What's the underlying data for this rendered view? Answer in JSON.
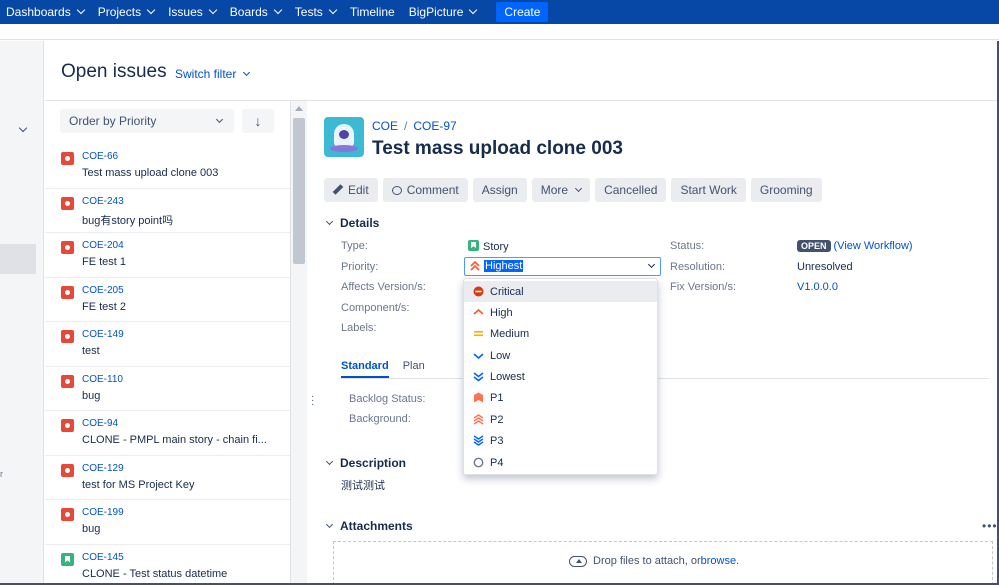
{
  "nav": {
    "items": [
      {
        "label": "Dashboards",
        "has_menu": true
      },
      {
        "label": "Projects",
        "has_menu": true
      },
      {
        "label": "Issues",
        "has_menu": true
      },
      {
        "label": "Boards",
        "has_menu": true
      },
      {
        "label": "Tests",
        "has_menu": true
      },
      {
        "label": "Timeline",
        "has_menu": false
      },
      {
        "label": "BigPicture",
        "has_menu": true
      }
    ],
    "create_label": "Create"
  },
  "page": {
    "title": "Open issues",
    "switch_filter": "Switch filter"
  },
  "list": {
    "order_by": "Order by Priority",
    "sort_icon": "↓",
    "issues": [
      {
        "key": "COE-66",
        "summary": "Test mass upload clone 003",
        "type": "bug"
      },
      {
        "key": "COE-243",
        "summary": "bug有story point吗",
        "type": "bug"
      },
      {
        "key": "COE-204",
        "summary": "FE test 1",
        "type": "bug"
      },
      {
        "key": "COE-205",
        "summary": "FE test 2",
        "type": "bug"
      },
      {
        "key": "COE-149",
        "summary": "test",
        "type": "bug"
      },
      {
        "key": "COE-110",
        "summary": "bug",
        "type": "bug"
      },
      {
        "key": "COE-94",
        "summary": "CLONE - PMPL main story - chain fi...",
        "type": "bug"
      },
      {
        "key": "COE-129",
        "summary": "test for MS Project Key",
        "type": "bug"
      },
      {
        "key": "COE-199",
        "summary": "bug",
        "type": "bug"
      },
      {
        "key": "COE-145",
        "summary": "CLONE - Test status datetime",
        "type": "story"
      }
    ]
  },
  "issue": {
    "project": "COE",
    "key": "COE-97",
    "title": "Test mass upload clone 003",
    "actions": {
      "edit": "Edit",
      "comment": "Comment",
      "assign": "Assign",
      "more": "More",
      "cancelled": "Cancelled",
      "start_work": "Start Work",
      "grooming": "Grooming"
    },
    "details": {
      "section": "Details",
      "type_label": "Type:",
      "type_value": "Story",
      "priority_label": "Priority:",
      "priority_value": "Highest",
      "affects_label": "Affects Version/s:",
      "component_label": "Component/s:",
      "labels_label": "Labels:",
      "status_label": "Status:",
      "status_value": "OPEN",
      "view_workflow": "(View Workflow)",
      "resolution_label": "Resolution:",
      "resolution_value": "Unresolved",
      "fix_label": "Fix Version/s:",
      "fix_value": "V1.0.0.0"
    },
    "priority_options": [
      {
        "label": "Critical",
        "icon": "critical-icon",
        "color": "#de350b"
      },
      {
        "label": "High",
        "icon": "high-icon",
        "color": "#ff5630"
      },
      {
        "label": "Medium",
        "icon": "medium-icon",
        "color": "#ffab00"
      },
      {
        "label": "Low",
        "icon": "low-icon",
        "color": "#0065ff"
      },
      {
        "label": "Lowest",
        "icon": "lowest-icon",
        "color": "#0065ff"
      },
      {
        "label": "P1",
        "icon": "p1-icon",
        "color": "#ff7452"
      },
      {
        "label": "P2",
        "icon": "p2-icon",
        "color": "#ff7452"
      },
      {
        "label": "P3",
        "icon": "p3-icon",
        "color": "#0065ff"
      },
      {
        "label": "P4",
        "icon": "p4-icon",
        "color": "#6b778c"
      }
    ],
    "tabs": [
      "Standard",
      "Plan"
    ],
    "standard": {
      "backlog_label": "Backlog Status:",
      "background_label": "Background:"
    },
    "description": {
      "section": "Description",
      "text": "测试测试"
    },
    "attachments": {
      "section": "Attachments",
      "more": "•••",
      "drop_text": "Drop files to attach, or ",
      "browse": "browse."
    }
  },
  "colors": {
    "nav_bg": "#0747a6",
    "create_bg": "#0065ff",
    "link": "#0052cc",
    "bug": "#e5493a",
    "story": "#36b37e"
  }
}
